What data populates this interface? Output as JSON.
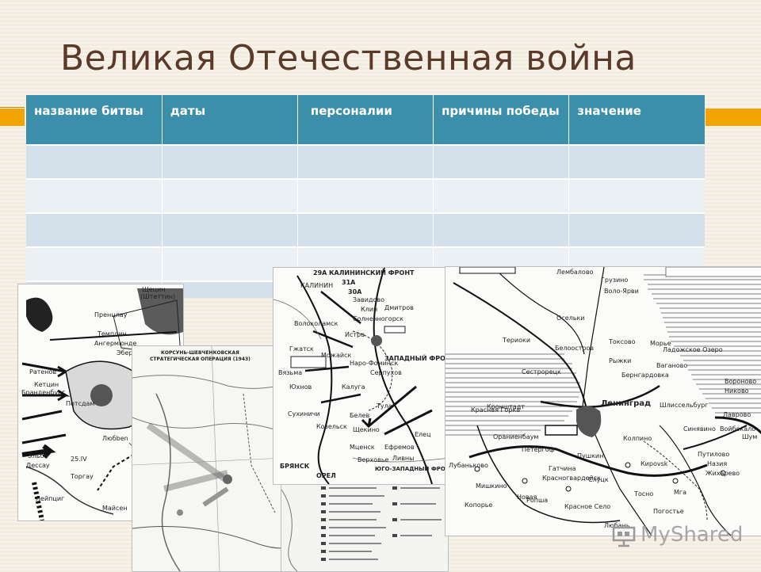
{
  "slide": {
    "title": "Великая Отечественная война",
    "accent_color": "#f2a400",
    "title_color": "#5b3a29"
  },
  "table": {
    "header_color": "#3c8faa",
    "columns": [
      "название битвы",
      "даты",
      "персоналии",
      "причины победы",
      "значение"
    ],
    "row_count": 5
  },
  "maps": {
    "berlin": {
      "labels": [
        "Щецин",
        "(Штеттин)",
        "Пренцлау",
        "Темплин",
        "Ангермюнде",
        "Эберсвальде",
        "Ратенов",
        "Кетцин",
        "Бранденбург",
        "Потсдам",
        "Любben",
        "Эльба",
        "Дессау",
        "Торгау",
        "25.IV",
        "Лейпциг",
        "Майсен"
      ]
    },
    "moscow": {
      "labels": [
        "КАЛИНИНСКИЙ ФРОНТ",
        "29А",
        "31А",
        "30А",
        "КАЛИНИН",
        "Завидово",
        "Клин",
        "Дмитров",
        "Солнечногорск",
        "Волоколамск",
        "Истра",
        "Гжатск",
        "Вязьма",
        "Можайск",
        "Наро-Фоминск",
        "ЗАПАДНЫЙ ФРОНТ",
        "Серпухов",
        "Калуга",
        "Тула",
        "Юхнов",
        "Сухиничи",
        "Козельск",
        "Белев",
        "Щекино",
        "Мценск",
        "Ефремов",
        "БРЯНСК",
        "ОРЕЛ",
        "ЮГО-ЗАПАДНЫЙ ФРОНТ",
        "Верховье",
        "Ливны",
        "Елец"
      ]
    },
    "mid": {
      "labels": [
        "КОРСУНЬ-ШЕВЧЕНКОВСКАЯ",
        "СТРАТЕГИЧЕСКАЯ ОПЕРАЦИЯ (1943)"
      ]
    },
    "leningrad": {
      "labels": [
        "Лембалово",
        "Грузино",
        "Воло-Ярви",
        "Осельки",
        "Териоки",
        "Белоостров",
        "Токсово",
        "Морье",
        "Ладожское Озеро",
        "Сестрорецк",
        "Кронштадт",
        "Рыжки",
        "Бернгардовка",
        "Ваганово",
        "Ленинград",
        "Красная Горка",
        "Ораниенбаум",
        "Петергоф",
        "Колпино",
        "Мга",
        "Синявино",
        "Шлиссельбург",
        "Путилово",
        "Назия",
        "Жихарево",
        "Ропша",
        "Красное Село",
        "Пушкин",
        "Слуцк",
        "Тосно",
        "Любань",
        "Кирovsk",
        "Шум",
        "Войбокало",
        "Лаврово",
        "Никово",
        "Вороново",
        "Погостье",
        "Мишкино",
        "Новая",
        "Копорье",
        "Лубаньково",
        "Гатчина",
        "Красногвардейск"
      ]
    }
  },
  "watermark": {
    "text": "MyShared"
  }
}
